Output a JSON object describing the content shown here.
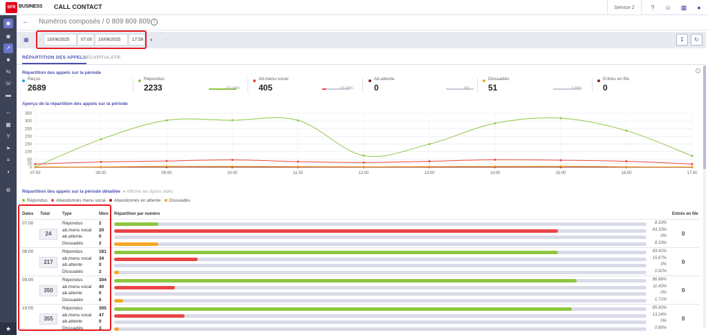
{
  "topbar": {
    "logo": "SFR",
    "brand": "BUSINESS",
    "app_title": "CALL CONTACT",
    "service": "Service 2"
  },
  "page": {
    "title": "Numéros composés / 0 809 809 809"
  },
  "toolbar": {
    "start_date": "10/06/2025",
    "start_time": "07:00",
    "end_date": "10/06/2025",
    "end_time": "17:59"
  },
  "tabs": [
    {
      "label": "RÉPARTITION DES APPELS"
    },
    {
      "label": "RÉCAPITULATIF"
    }
  ],
  "summary": {
    "title": "Répartition des appels sur la période",
    "stats": [
      {
        "label": "Reçus",
        "value": "2689",
        "pct": "",
        "color": "#2f9ce0"
      },
      {
        "label": "Répondus",
        "value": "2233",
        "pct": "83.04%",
        "color": "#8cc63f"
      },
      {
        "label": "Ab.menu vocal",
        "value": "405",
        "pct": "15.06%",
        "color": "#e84545"
      },
      {
        "label": "Ab.attente",
        "value": "0",
        "pct": "0%",
        "color": "#8b1f1f"
      },
      {
        "label": "Dissuadés",
        "value": "51",
        "pct": "1.90%",
        "color": "#f5a623"
      },
      {
        "label": "Entrés en file",
        "value": "0",
        "pct": "",
        "color": "#8b1f1f"
      }
    ]
  },
  "chart_section": {
    "title": "Aperçu de la répartition des appels sur la période"
  },
  "chart_data": {
    "type": "line",
    "x": [
      "07:00",
      "08:00",
      "09:00",
      "10:00",
      "11:00",
      "12:00",
      "13:00",
      "14:00",
      "15:00",
      "16:00",
      "17:00"
    ],
    "ylim": [
      0,
      350
    ],
    "yticks": [
      0,
      25,
      50,
      100,
      150,
      200,
      250,
      300,
      350
    ],
    "series": [
      {
        "name": "Répondus",
        "color": "#8cc63f",
        "values": [
          2,
          181,
          304,
          305,
          304,
          75,
          150,
          285,
          318,
          237,
          73
        ]
      },
      {
        "name": "Abandonnés menu vocal",
        "color": "#e84545",
        "values": [
          20,
          34,
          40,
          47,
          36,
          30,
          38,
          48,
          45,
          38,
          20
        ]
      },
      {
        "name": "Abandonnés en attente",
        "color": "#8b1f1f",
        "values": [
          0,
          0,
          0,
          0,
          0,
          0,
          0,
          0,
          0,
          0,
          0
        ]
      },
      {
        "name": "Dissuadés",
        "color": "#f5a623",
        "values": [
          2,
          2,
          6,
          5,
          4,
          3,
          4,
          5,
          6,
          3,
          2
        ]
      }
    ],
    "grid": true
  },
  "detail": {
    "title": "Répartition des appels sur la période détaillée",
    "toggle": "Afficher les lignes vides",
    "legend": [
      {
        "label": "Répondus",
        "color": "#8cc63f"
      },
      {
        "label": "Abandonnés menu vocal",
        "color": "#e84545"
      },
      {
        "label": "Abandonnés en attente",
        "color": "#8b1f1f"
      },
      {
        "label": "Dissuadés",
        "color": "#f5a623"
      }
    ],
    "headers": {
      "dates": "Dates",
      "total": "Total",
      "type": "Type",
      "nbre": "Nbre",
      "repartition": "Répartition par numéro",
      "entres": "Entrés en file"
    },
    "rows": [
      {
        "time": "07:00",
        "total": "24",
        "entres": "0",
        "lines": [
          {
            "type": "Répondus",
            "nb": "2",
            "pct": "8.33%",
            "ratio": 0.0833,
            "color": "#8cc63f"
          },
          {
            "type": "ab.menu vocal",
            "nb": "20",
            "pct": "83.33%",
            "ratio": 0.8333,
            "color": "#e84545"
          },
          {
            "type": "ab.attente",
            "nb": "0",
            "pct": "0%",
            "ratio": 0,
            "color": "#8b1f1f"
          },
          {
            "type": "Dissuadés",
            "nb": "2",
            "pct": "8.33%",
            "ratio": 0.0833,
            "color": "#f5a623"
          }
        ]
      },
      {
        "time": "08:00",
        "total": "217",
        "entres": "0",
        "lines": [
          {
            "type": "Répondus",
            "nb": "181",
            "pct": "83.41%",
            "ratio": 0.8341,
            "color": "#8cc63f"
          },
          {
            "type": "ab.menu vocal",
            "nb": "34",
            "pct": "15.67%",
            "ratio": 0.1567,
            "color": "#e84545"
          },
          {
            "type": "ab.attente",
            "nb": "0",
            "pct": "0%",
            "ratio": 0,
            "color": "#8b1f1f"
          },
          {
            "type": "Dissuadés",
            "nb": "2",
            "pct": "0.92%",
            "ratio": 0.0092,
            "color": "#f5a623"
          }
        ]
      },
      {
        "time": "09:00",
        "total": "350",
        "entres": "0",
        "lines": [
          {
            "type": "Répondus",
            "nb": "304",
            "pct": "86.86%",
            "ratio": 0.8686,
            "color": "#8cc63f"
          },
          {
            "type": "ab.menu vocal",
            "nb": "40",
            "pct": "11.43%",
            "ratio": 0.1143,
            "color": "#e84545"
          },
          {
            "type": "ab.attente",
            "nb": "0",
            "pct": "0%",
            "ratio": 0,
            "color": "#8b1f1f"
          },
          {
            "type": "Dissuadés",
            "nb": "6",
            "pct": "1.71%",
            "ratio": 0.0171,
            "color": "#f5a623"
          }
        ]
      },
      {
        "time": "10:00",
        "total": "355",
        "entres": "0",
        "lines": [
          {
            "type": "Répondus",
            "nb": "305",
            "pct": "85.92%",
            "ratio": 0.8592,
            "color": "#8cc63f"
          },
          {
            "type": "ab.menu vocal",
            "nb": "47",
            "pct": "13.24%",
            "ratio": 0.1324,
            "color": "#e84545"
          },
          {
            "type": "ab.attente",
            "nb": "0",
            "pct": "0%",
            "ratio": 0,
            "color": "#8b1f1f"
          },
          {
            "type": "Dissuadés",
            "nb": "3",
            "pct": "0.85%",
            "ratio": 0.0085,
            "color": "#f5a623"
          }
        ]
      }
    ]
  },
  "icons": {
    "top": [
      "help-icon",
      "users-icon",
      "grid-icon",
      "account-icon"
    ],
    "sidebar": [
      "headset-icon",
      "eye-icon",
      "trend-icon",
      "save-icon",
      "routing-icon",
      "phone-icon",
      "folder-icon",
      "transfer-icon",
      "calendar-icon",
      "fork-icon",
      "arrow-icon",
      "queue-icon",
      "headphones-icon",
      "settings-icon",
      "star-icon"
    ],
    "toolbar": [
      "calendar-icon",
      "contrast-icon",
      "download-icon",
      "refresh-icon"
    ]
  }
}
